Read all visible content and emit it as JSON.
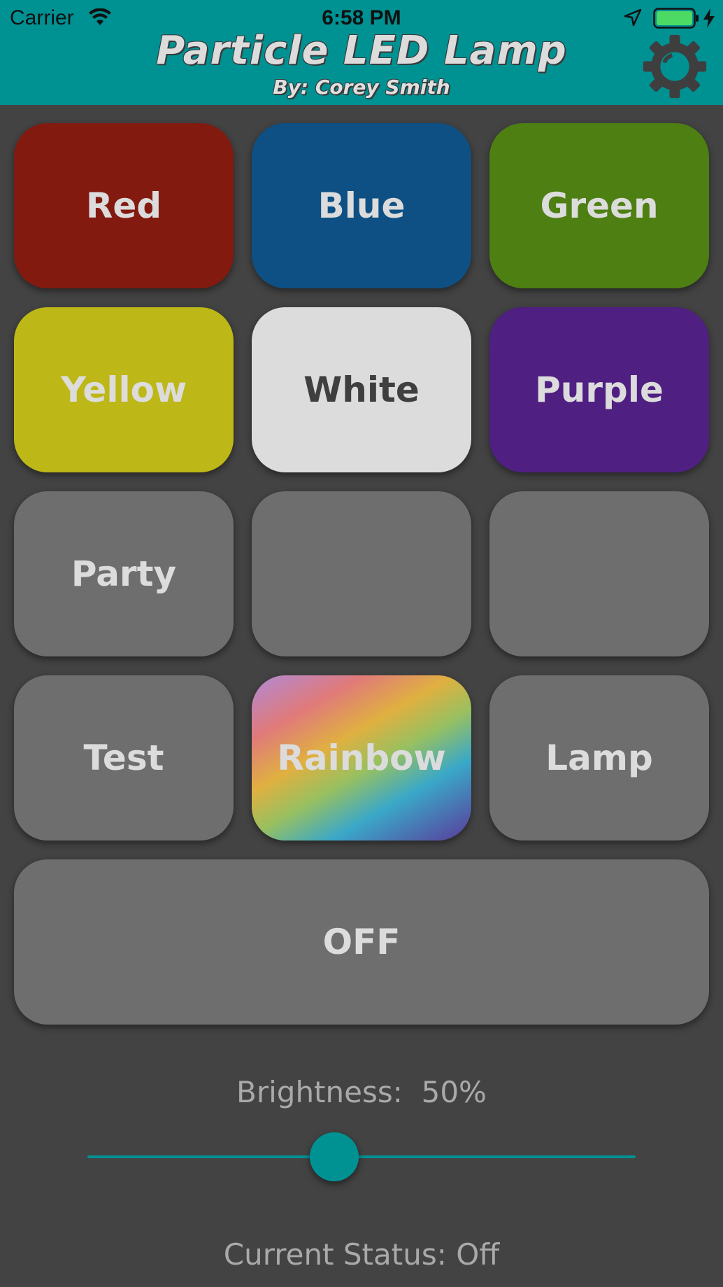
{
  "status_bar": {
    "carrier": "Carrier",
    "time": "6:58 PM",
    "icons": [
      "wifi-icon",
      "location-arrow-icon",
      "battery-icon",
      "charging-bolt-icon"
    ]
  },
  "header": {
    "title": "Particle LED Lamp",
    "subtitle": "By: Corey Smith",
    "settings_icon": "gear-icon",
    "background": "#009193"
  },
  "buttons": [
    {
      "label": "Red",
      "color": "#831a10"
    },
    {
      "label": "Blue",
      "color": "#0e5083"
    },
    {
      "label": "Green",
      "color": "#4d7f12"
    },
    {
      "label": "Yellow",
      "color": "#bdb717"
    },
    {
      "label": "White",
      "color": "#dcdcdc"
    },
    {
      "label": "Purple",
      "color": "#4f1f82"
    },
    {
      "label": "Party",
      "color": "#6e6e6e"
    },
    {
      "label": "",
      "color": "#6e6e6e"
    },
    {
      "label": "",
      "color": "#6e6e6e"
    },
    {
      "label": "Test",
      "color": "#6e6e6e"
    },
    {
      "label": "Rainbow",
      "color": "rainbow-gradient"
    },
    {
      "label": "Lamp",
      "color": "#6e6e6e"
    }
  ],
  "off_button": {
    "label": "OFF",
    "color": "#6e6e6e"
  },
  "brightness": {
    "label": "Brightness:",
    "value_text": "50%",
    "value": 0.45,
    "accent": "#009193"
  },
  "status": {
    "text": "Current Status: Off"
  }
}
